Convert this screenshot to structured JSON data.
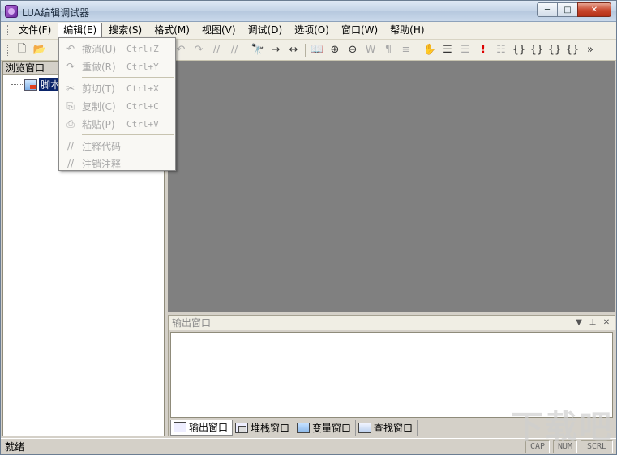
{
  "window": {
    "title": "LUA编辑调试器",
    "min": "─",
    "max": "□",
    "close": "✕"
  },
  "menu": [
    "文件(F)",
    "编辑(E)",
    "搜索(S)",
    "格式(M)",
    "视图(V)",
    "调试(D)",
    "选项(O)",
    "窗口(W)",
    "帮助(H)"
  ],
  "edit_menu": [
    {
      "icon": "↶",
      "label": "撤消(U)",
      "shortcut": "Ctrl+Z"
    },
    {
      "icon": "↷",
      "label": "重做(R)",
      "shortcut": "Ctrl+Y"
    },
    {
      "icon": "✂",
      "label": "剪切(T)",
      "shortcut": "Ctrl+X"
    },
    {
      "icon": "⎘",
      "label": "复制(C)",
      "shortcut": "Ctrl+C"
    },
    {
      "icon": "⎙",
      "label": "粘贴(P)",
      "shortcut": "Ctrl+V"
    },
    {
      "icon": "//",
      "label": "注释代码",
      "shortcut": ""
    },
    {
      "icon": "∕/",
      "label": "注销注释",
      "shortcut": ""
    }
  ],
  "toolbar": {
    "new": "🗋",
    "open": "📂",
    "undo": "↶",
    "redo": "↷",
    "comment": "//",
    "uncomment": "∕∕",
    "find": "🔭",
    "find_next": "→",
    "replace": "↔",
    "bookmark": "📖",
    "zoom_in": "⊕",
    "zoom_out": "⊖",
    "whitespace": "W",
    "paragraph": "¶",
    "indent": "≡",
    "hand": "✋",
    "layers": "☰",
    "list": "☰",
    "breakpoint": "!",
    "step": "☷",
    "step_into": "{}",
    "step_over": "{}",
    "step_out": "{}",
    "run_to": "{}",
    "more": "»"
  },
  "left_panel": {
    "title": "浏览窗口",
    "tree_item": "脚本"
  },
  "output": {
    "title": "输出窗口",
    "dropdown": "▼",
    "pin": "⊥",
    "close": "✕",
    "tabs": [
      "输出窗口",
      "堆栈窗口",
      "变量窗口",
      "查找窗口"
    ]
  },
  "status": {
    "text": "就绪",
    "cap": "CAP",
    "num": "NUM",
    "scrl": "SCRL"
  },
  "watermark": "下载吧"
}
